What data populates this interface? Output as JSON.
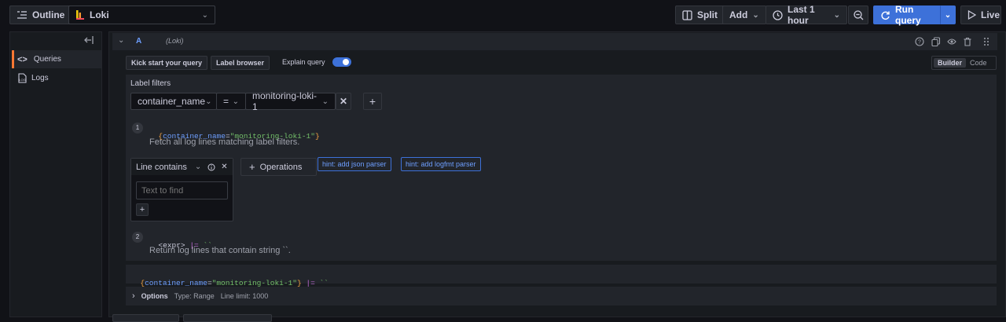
{
  "toolbar": {
    "outline_label": "Outline",
    "datasource": "Loki",
    "split_label": "Split",
    "add_label": "Add",
    "time_range": "Last 1 hour",
    "run_query_label": "Run query",
    "live_label": "Live"
  },
  "sidebar": {
    "items": [
      {
        "label": "Queries",
        "active": true
      },
      {
        "label": "Logs",
        "active": false
      }
    ]
  },
  "query": {
    "ref_id": "A",
    "datasource_hint": "(Loki)",
    "kick_start_label": "Kick start your query",
    "label_browser_label": "Label browser",
    "explain_label": "Explain query",
    "explain_on": true,
    "mode_builder": "Builder",
    "mode_code": "Code",
    "label_filters_title": "Label filters",
    "filter": {
      "label": "container_name",
      "op": "=",
      "value": "monitoring-loki-1"
    },
    "step1": {
      "num": "1",
      "code_open": "{",
      "code_key": "container_name",
      "code_eq": "=",
      "code_val": "\"monitoring-loki-1\"",
      "code_close": "}",
      "desc": "Fetch all log lines matching label filters."
    },
    "line_contains": {
      "title": "Line contains",
      "placeholder": "Text to find"
    },
    "operations_label": "Operations",
    "hints": [
      "hint: add json parser",
      "hint: add logfmt parser"
    ],
    "step2": {
      "num": "2",
      "code_expr": "<expr>",
      "code_op": "|=",
      "code_str": "``",
      "desc": "Return log lines that contain string ``."
    },
    "raw_query": {
      "open": "{",
      "key": "container_name",
      "eq": "=",
      "val": "\"monitoring-loki-1\"",
      "close": "}",
      "op": "|=",
      "str": "``"
    },
    "options": {
      "label": "Options",
      "type": "Type: Range",
      "line_limit": "Line limit: 1000"
    }
  },
  "colors": {
    "accent_orange": "#ff7833",
    "primary_blue": "#3d71d9",
    "link_blue": "#6e9fff",
    "code_orange": "#f5a442",
    "code_green": "#73bf69",
    "code_purple": "#c06bd6"
  }
}
